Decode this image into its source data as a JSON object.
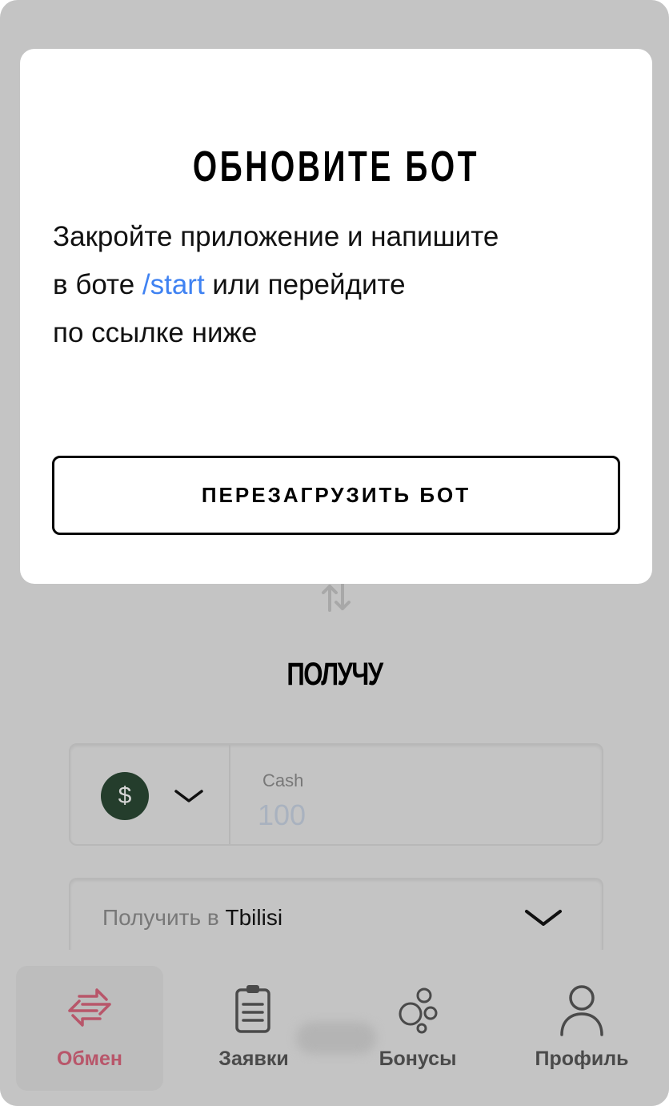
{
  "modal": {
    "title": "ОБНОВИТЕ БОТ",
    "text_line1": "Закройте приложение и напишите",
    "text_line2_before": "в боте ",
    "text_command": "/start",
    "text_line2_after": " или перейдите",
    "text_line3": "по ссылке ниже",
    "button_label": "ПЕРЕЗАГРУЗИТЬ БОТ"
  },
  "exchange": {
    "swap_icon": "swap-vertical-icon",
    "receive_title": "ПОЛУЧУ",
    "currency": {
      "icon": "dollar-icon",
      "symbol": "$",
      "label": "Cash",
      "amount_placeholder": "100"
    },
    "city": {
      "prefix": "Получить в ",
      "value": "Tbilisi"
    }
  },
  "nav": {
    "items": [
      {
        "label": "Обмен",
        "icon": "exchange-arrows-icon",
        "active": true
      },
      {
        "label": "Заявки",
        "icon": "clipboard-icon",
        "active": false
      },
      {
        "label": "Бонусы",
        "icon": "bubbles-icon",
        "active": false
      },
      {
        "label": "Профиль",
        "icon": "user-icon",
        "active": false
      }
    ]
  },
  "colors": {
    "overlay_background": "#c4c4c4",
    "link": "#3f82f2",
    "active_nav": "#b8566a",
    "currency_badge": "#243d2c"
  }
}
